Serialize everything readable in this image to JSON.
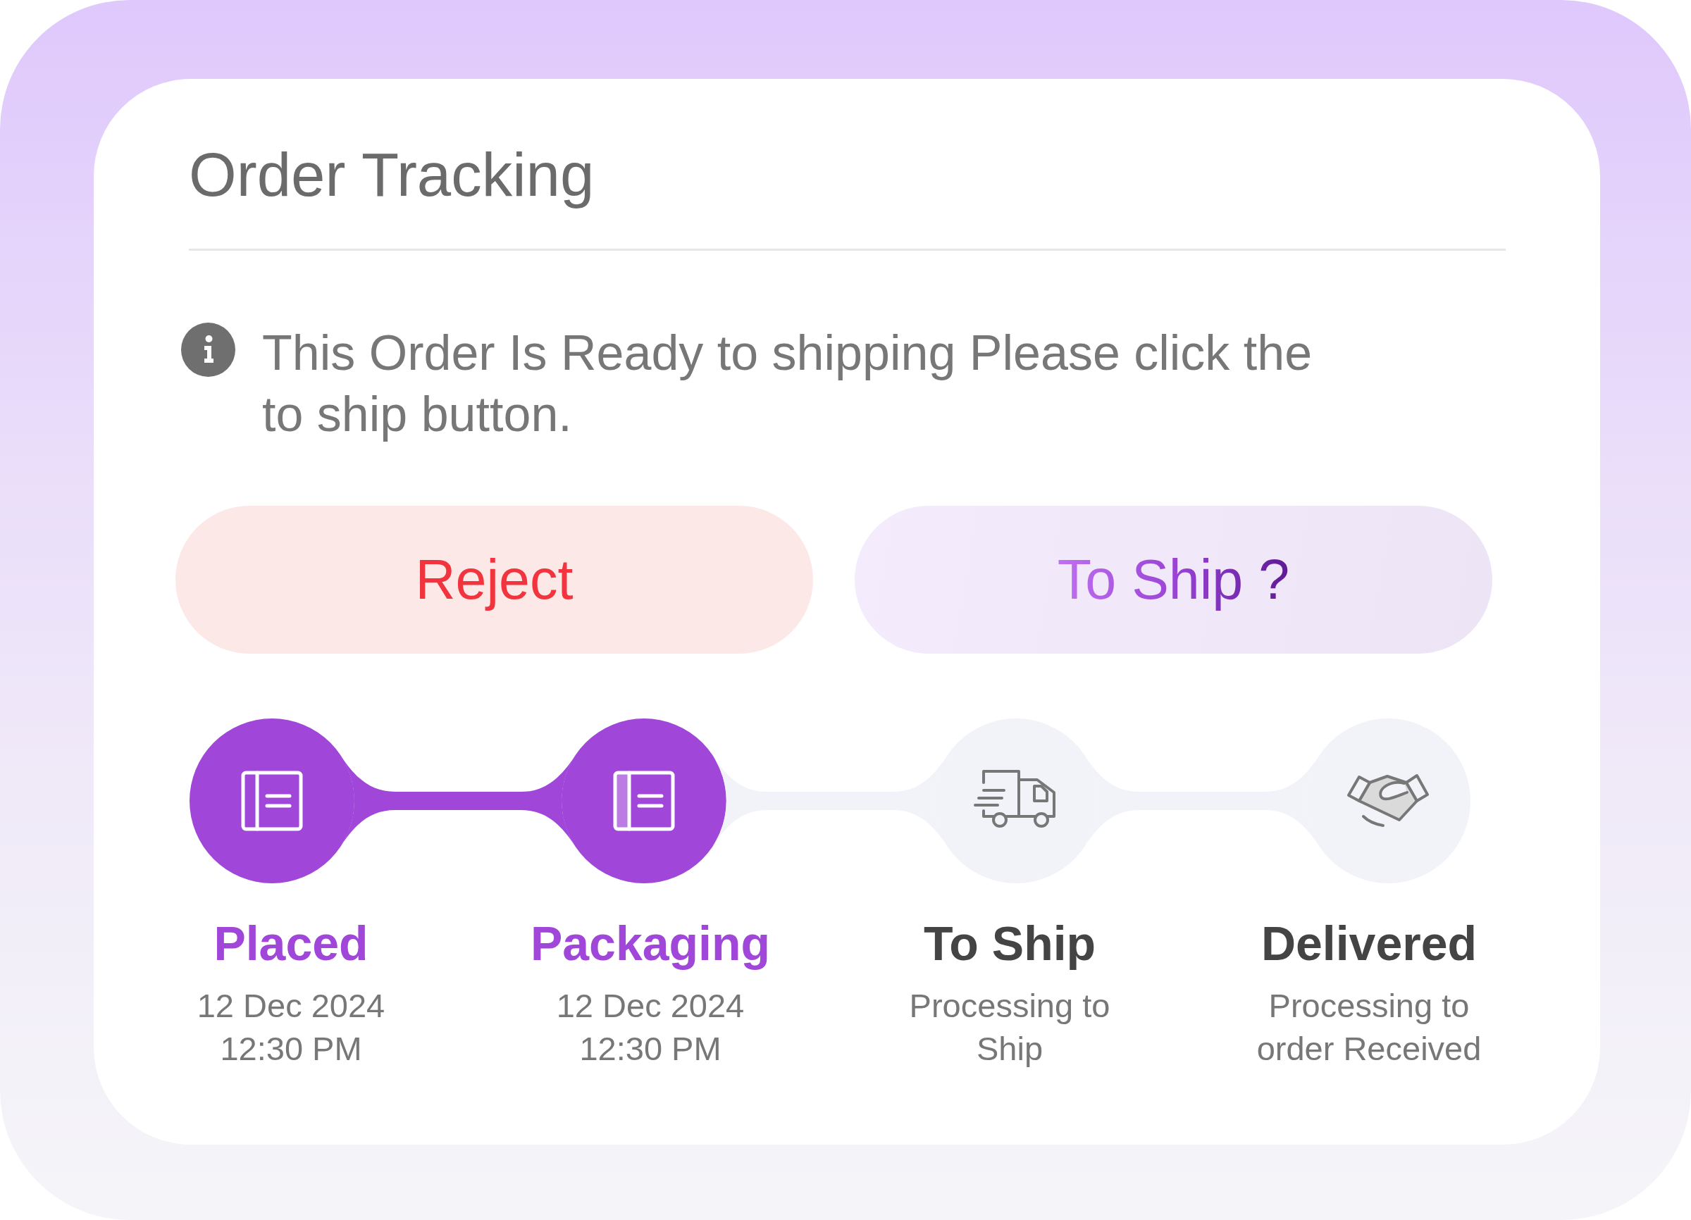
{
  "title": "Order Tracking",
  "notice": {
    "text": "This Order Is Ready to shipping Please click the to ship button."
  },
  "buttons": [
    {
      "label": "Reject",
      "kind": "reject"
    },
    {
      "label": "To Ship ?",
      "kind": "confirm"
    }
  ],
  "steps": [
    {
      "kind": "order",
      "label": "Placed",
      "detail": "12 Dec 2024 12:30 PM",
      "done": true
    },
    {
      "kind": "package",
      "label": "Packaging",
      "detail": "12 Dec 2024 12:30 PM",
      "done": true
    },
    {
      "kind": "shipment",
      "label": "To Ship",
      "detail": "Processing to Ship",
      "done": false
    },
    {
      "kind": "delivery",
      "label": "Delivered",
      "detail": "Processing to order Received",
      "done": false
    }
  ]
}
